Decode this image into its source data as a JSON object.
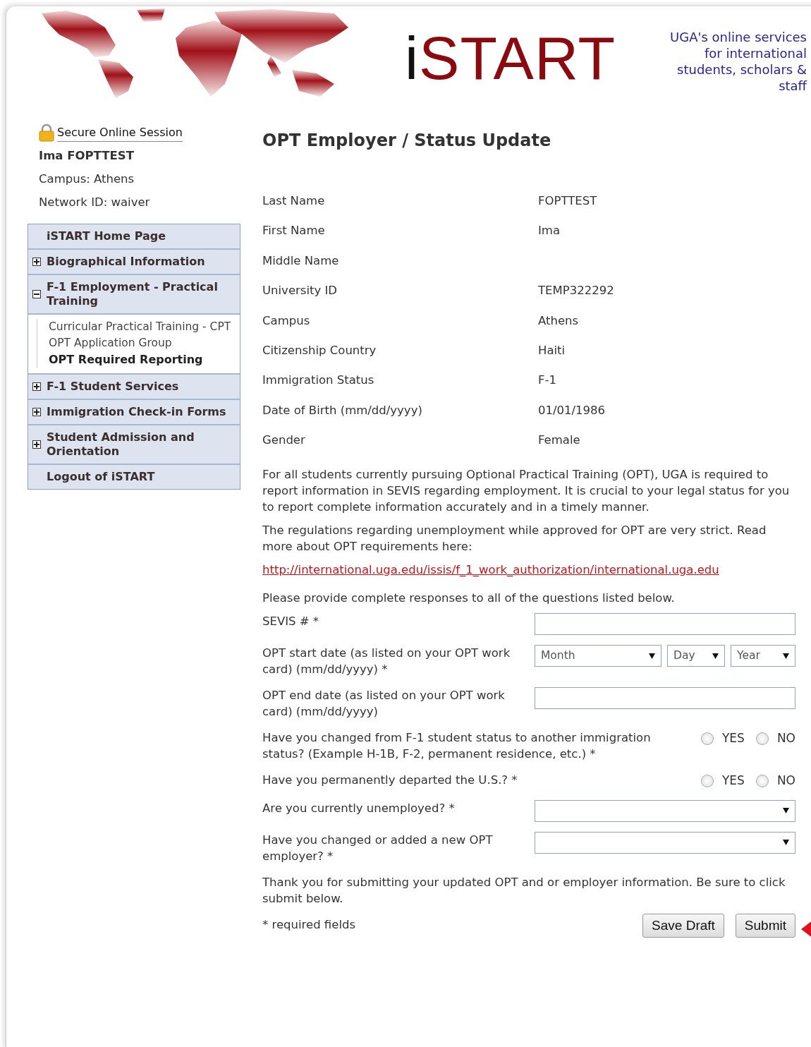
{
  "header": {
    "logo_prefix": "i",
    "logo_main": "START",
    "tagline": "UGA's online services for international students, scholars & staff"
  },
  "session": {
    "secure_label": "Secure Online Session",
    "user": "Ima FOPTTEST",
    "campus": "Campus: Athens",
    "network_id": "Network ID: waiver"
  },
  "nav": [
    {
      "label": "iSTART Home Page",
      "kind": "link"
    },
    {
      "label": "Biographical Information",
      "kind": "group",
      "expanded": false
    },
    {
      "label": "F-1 Employment - Practical Training",
      "kind": "group",
      "expanded": true,
      "children": [
        {
          "label": "Curricular Practical Training - CPT",
          "selected": false
        },
        {
          "label": "OPT Application Group",
          "selected": false
        },
        {
          "label": "OPT Required Reporting",
          "selected": true
        }
      ]
    },
    {
      "label": "F-1 Student Services",
      "kind": "group",
      "expanded": false
    },
    {
      "label": "Immigration Check-in Forms",
      "kind": "group",
      "expanded": false
    },
    {
      "label": "Student Admission and Orientation",
      "kind": "group",
      "expanded": false
    },
    {
      "label": "Logout of iSTART",
      "kind": "link"
    }
  ],
  "main": {
    "title": "OPT Employer / Status Update",
    "fields": [
      {
        "label": "Last Name",
        "value": "FOPTTEST"
      },
      {
        "label": "First Name",
        "value": "Ima"
      },
      {
        "label": "Middle Name"
      },
      {
        "label": "University ID",
        "value": "TEMP322292"
      },
      {
        "label": "Campus",
        "value": "Athens"
      },
      {
        "label": "Citizenship Country",
        "value": "Haiti"
      },
      {
        "label": "Immigration Status",
        "value": "F-1"
      },
      {
        "label": "Date of Birth (mm/dd/yyyy)",
        "value": "01/01/1986"
      },
      {
        "label": "Gender",
        "value": "Female"
      }
    ],
    "paragraphs": [
      "For all students currently pursuing Optional Practical Training (OPT), UGA is required to report information in SEVIS regarding employment. It is crucial to your legal status for you to report complete information accurately and in a timely manner.",
      "The regulations regarding unemployment while approved for OPT are very strict. Read more about OPT requirements here:"
    ],
    "link": "http://international.uga.edu/issis/f_1_work_authorization/international.uga.edu",
    "instructions": "Please provide complete responses to all of the questions listed below.",
    "questions": [
      {
        "kind": "text",
        "label": "SEVIS # *"
      },
      {
        "kind": "date",
        "label": "OPT start date (as listed on your OPT work card) (mm/dd/yyyy) *",
        "parts": [
          "Month",
          "Day",
          "Year"
        ]
      },
      {
        "kind": "text",
        "label": "OPT end date (as listed on your OPT work card) (mm/dd/yyyy)"
      },
      {
        "kind": "radio",
        "label": "Have you changed from F-1 student status to another immigration status? (Example H-1B, F-2, permanent residence, etc.) *",
        "options": [
          {
            "label": "YES",
            "selected": false
          },
          {
            "label": "NO",
            "selected": false
          }
        ]
      },
      {
        "kind": "radio",
        "label": "Have you permanently departed the U.S.? *",
        "options": [
          {
            "label": "YES",
            "selected": false
          },
          {
            "label": "NO",
            "selected": false
          }
        ]
      },
      {
        "kind": "select",
        "label": "Are you currently unemployed? *"
      },
      {
        "kind": "select",
        "label": "Have you changed or added a new OPT employer? *"
      }
    ],
    "closing": "Thank you for submitting your updated OPT and or employer information.  Be sure to click submit below.",
    "required_note": "* required fields",
    "buttons": [
      "Save Draft",
      "Submit"
    ]
  }
}
